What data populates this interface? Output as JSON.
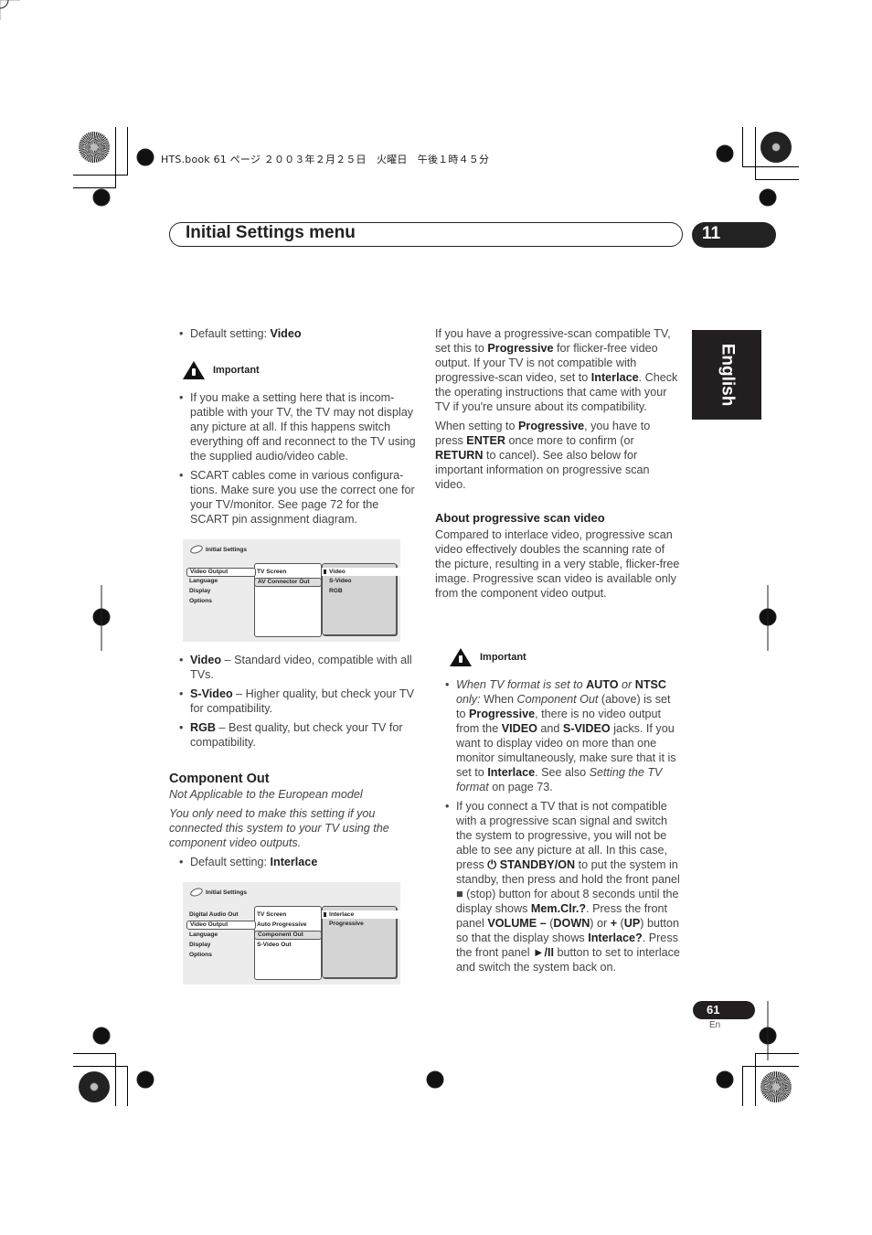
{
  "print_header": "HTS.book  61 ページ  ２００３年２月２５日　火曜日　午後１時４５分",
  "chapter": {
    "title": "Initial Settings menu",
    "number": "11"
  },
  "language_tab": "English",
  "left_column": {
    "default_setting_1": {
      "label": "Default setting: ",
      "value": "Video"
    },
    "important_label": "Important",
    "important_bullets": [
      "If you make a setting here that is incom-patible with your TV, the TV may not display any picture at all. If this happens switch everything off and reconnect to the TV using the supplied audio/video cable.",
      "SCART cables come in various configura-tions. Make sure you use the correct one for your TV/monitor. See page 72 for the SCART pin assignment diagram."
    ],
    "screen1": {
      "title": "Initial Settings",
      "left_menu": [
        "Video Output",
        "Language",
        "Display",
        "Options"
      ],
      "left_selected": "Video Output",
      "mid_menu": [
        "TV Screen",
        "AV Connector Out"
      ],
      "mid_selected": "AV Connector Out",
      "right_menu": [
        "Video",
        "S-Video",
        "RGB"
      ],
      "right_selected": "Video"
    },
    "option_bullets": [
      {
        "term": "Video",
        "desc": " – Standard video, compatible with all TVs."
      },
      {
        "term": "S-Video",
        "desc": " – Higher quality, but check your TV for compatibility."
      },
      {
        "term": "RGB",
        "desc": " – Best quality, but check your TV for compatibility."
      }
    ],
    "component_out": {
      "heading": "Component Out",
      "note1": "Not Applicable to the European model",
      "note2": "You only need to make this setting if you connected this system to your TV using the component video outputs.",
      "default_label": "Default setting: ",
      "default_value": "Interlace"
    },
    "screen2": {
      "title": "Initial Settings",
      "left_menu": [
        "Digital Audio Out",
        "Video Output",
        "Language",
        "Display",
        "Options"
      ],
      "left_selected": "Video Output",
      "mid_menu": [
        "TV Screen",
        "Auto Progressive",
        "Component Out",
        "S-Video Out"
      ],
      "mid_selected": "Component Out",
      "right_menu": [
        "Interlace",
        "Progressive"
      ],
      "right_selected": "Interlace"
    }
  },
  "right_column": {
    "para1": {
      "t1": "If you have a progressive-scan compatible TV, set this to ",
      "b1": "Progressive",
      "t2": " for flicker-free video output. If your TV is not compatible with progressive-scan video, set to ",
      "b2": "Interlace",
      "t3": ". Check the operating instructions that came with your TV if you're unsure about its compatibility."
    },
    "para2": {
      "t1": "When setting to ",
      "b1": "Progressive",
      "t2": ", you have to press ",
      "b2": "ENTER",
      "t3": " once more to confirm (or ",
      "b3": "RETURN",
      "t4": " to cancel). See also below for important information on progressive scan video."
    },
    "about_heading": "About progressive scan video",
    "about_text": "Compared to interlace video, progressive scan video effectively doubles the scanning rate of the picture, resulting in a very stable, flicker-free image. Progressive scan video is available only from the component video output.",
    "important_label": "Important",
    "bullet1": {
      "i1": "When TV format is set to ",
      "b1": "AUTO",
      "i2": " or ",
      "b2": "NTSC",
      "i3": " only:",
      "t1": " When ",
      "i4": "Component Out",
      "t2": " (above) is set to ",
      "b3": "Progressive",
      "t3": ", there is no video output from the ",
      "b4": "VIDEO",
      "t4": " and ",
      "b5": "S-VIDEO",
      "t5": " jacks. If you want to display video on more than one monitor simultaneously, make sure that it is set to ",
      "b6": "Interlace",
      "t6": ". See also ",
      "i5": "Setting the TV format",
      "t7": " on page 73."
    },
    "bullet2": {
      "t1": "If you connect a TV that is not compatible with a progressive scan signal and switch the system to progressive, you will not be able to see any picture at all. In this case, press ",
      "power_icon": "⏻",
      "b1": " STANDBY/ON",
      "t2": " to put the system in standby, then press and hold the front panel ",
      "stop_icon": "■",
      "t3": " (stop) button for about 8 seconds until the display shows ",
      "b2": "Mem.Clr.?",
      "t4": ". Press the front panel ",
      "b3": "VOLUME –",
      "t5": " (",
      "b4": "DOWN",
      "t6": ") or ",
      "b5": "+",
      "t7": " (",
      "b6": "UP",
      "t8": ")  button so that the display shows ",
      "b7": "Interlace?",
      "t9": ". Press the front panel ",
      "b8": "►/II",
      "t10": " button to set to interlace and switch the system back on."
    }
  },
  "footer": {
    "page_number": "61",
    "lang_code": "En"
  }
}
